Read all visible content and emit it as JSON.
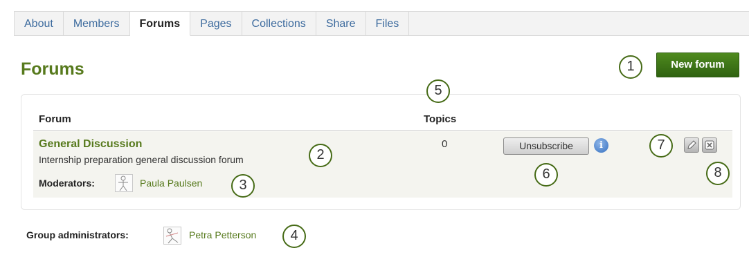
{
  "tabs": [
    {
      "label": "About"
    },
    {
      "label": "Members"
    },
    {
      "label": "Forums"
    },
    {
      "label": "Pages"
    },
    {
      "label": "Collections"
    },
    {
      "label": "Share"
    },
    {
      "label": "Files"
    }
  ],
  "active_tab": "Forums",
  "page": {
    "title": "Forums",
    "new_forum_label": "New forum"
  },
  "table": {
    "columns": [
      "Forum",
      "Topics"
    ],
    "rows": [
      {
        "name": "General Discussion",
        "description": "Internship preparation general discussion forum",
        "moderators_label": "Moderators:",
        "moderator": "Paula Paulsen",
        "topics": "0",
        "unsubscribe_label": "Unsubscribe",
        "info_glyph": "i"
      }
    ]
  },
  "group_admins": {
    "label": "Group administrators:",
    "name": "Petra Petterson"
  },
  "callouts": [
    "1",
    "2",
    "3",
    "4",
    "5",
    "6",
    "7",
    "8"
  ],
  "icons": {
    "edit": "pencil-icon",
    "delete": "delete-x-icon",
    "info": "info-icon",
    "avatar": "profile-image-icon"
  },
  "colors": {
    "accent_green": "#577a1d",
    "button_green": "#3d7516",
    "link_blue": "#3d6b9e"
  }
}
